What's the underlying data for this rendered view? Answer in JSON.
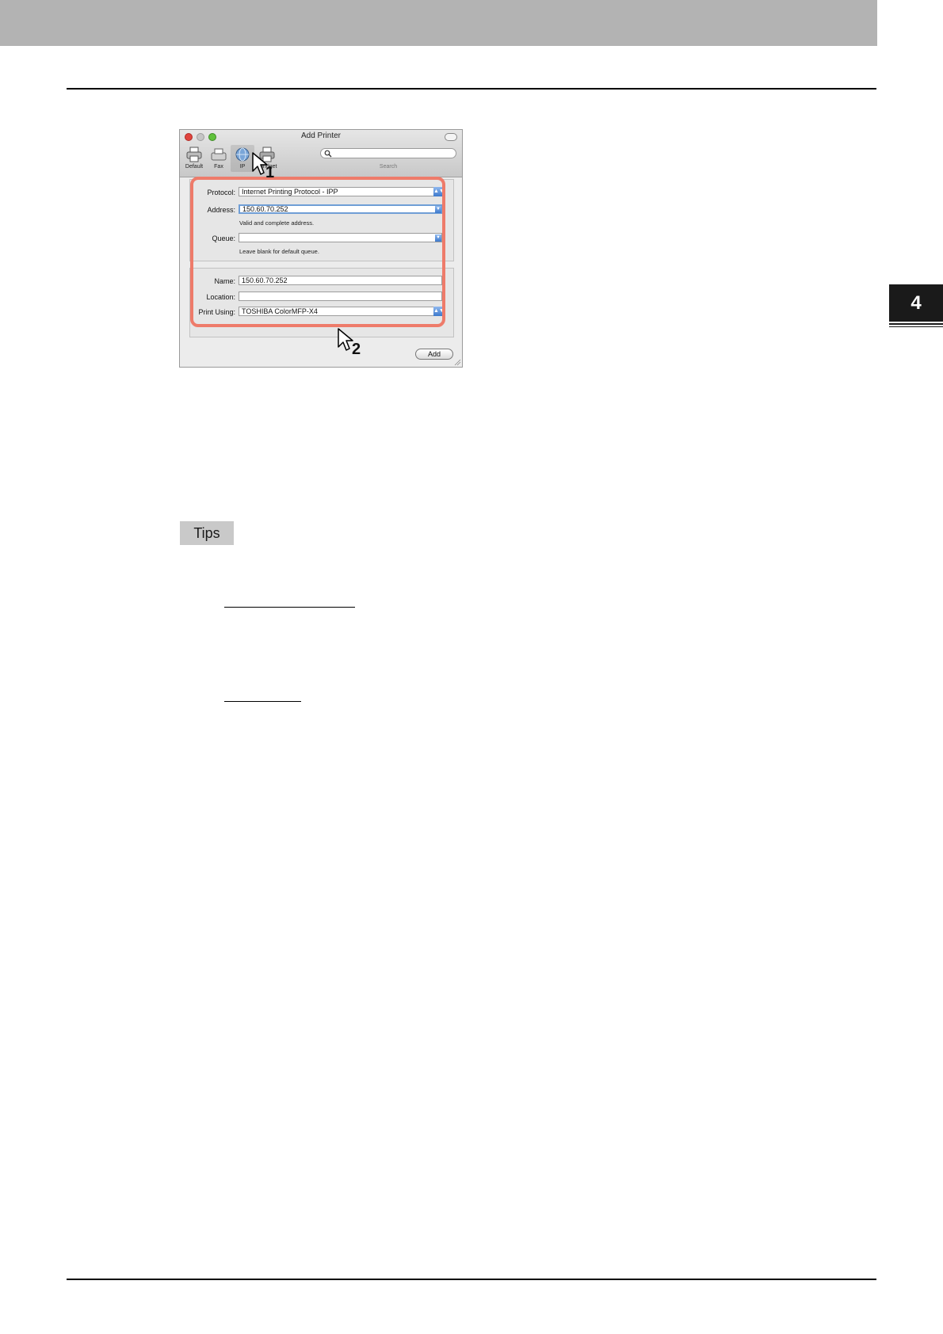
{
  "chapter": {
    "number": "4"
  },
  "tips": {
    "label": "Tips"
  },
  "screenshot": {
    "window_title": "Add Printer",
    "toolbar": {
      "items": [
        {
          "label": "Default",
          "icon": "printer-icon"
        },
        {
          "label": "Fax",
          "icon": "fax-icon"
        },
        {
          "label": "IP",
          "icon": "globe-icon",
          "selected": true
        },
        {
          "label": "...indget",
          "icon": "printer-icon"
        }
      ],
      "search_caption": "Search",
      "search_placeholder": ""
    },
    "protocol": {
      "label": "Protocol:",
      "value": "Internet Printing Protocol - IPP"
    },
    "address": {
      "label": "Address:",
      "value": "150.60.70.252",
      "hint": "Valid and complete address."
    },
    "queue": {
      "label": "Queue:",
      "value": "",
      "hint": "Leave blank for default queue."
    },
    "name": {
      "label": "Name:",
      "value": "150.60.70.252"
    },
    "location": {
      "label": "Location:",
      "value": ""
    },
    "print_using": {
      "label": "Print Using:",
      "value": "TOSHIBA ColorMFP-X4"
    },
    "add_button": "Add",
    "callouts": [
      "1",
      "2"
    ],
    "highlight_color": "#ee7b6a",
    "accent_color": "#3d79cc"
  },
  "colors": {
    "header_band": "#b3b3b3",
    "chapter_tab": "#1a1a1a",
    "tips_badge": "#c9c9c9"
  }
}
